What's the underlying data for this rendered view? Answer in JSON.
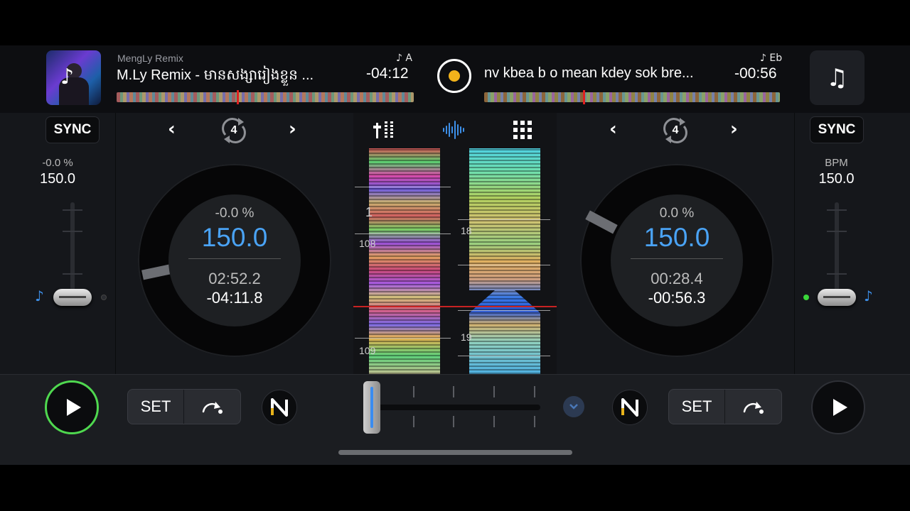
{
  "deck_a": {
    "artist": "MengLy Remix",
    "title": "M.Ly Remix - មានសង្សារៀងខ្លួន ...",
    "key": "♪ A",
    "remaining_header": "-04:12",
    "sync_label": "SYNC",
    "side_pitch": "-0.0 %",
    "side_bpm": "150.0",
    "loop_size": "4",
    "platter": {
      "pitch": "-0.0 %",
      "bpm": "150.0",
      "elapsed": "02:52.2",
      "remaining": "-04:11.8"
    },
    "set_label": "SET",
    "sync_state": "on"
  },
  "deck_b": {
    "title": "nv kbea b o mean kdey sok bre...",
    "key": "♪ Eb",
    "remaining_header": "-00:56",
    "sync_label": "SYNC",
    "side_label": "BPM",
    "side_bpm": "150.0",
    "loop_size": "4",
    "platter": {
      "pitch": "0.0 %",
      "bpm": "150.0",
      "elapsed": "00:28.4",
      "remaining": "-00:56.3"
    },
    "set_label": "SET"
  },
  "waveform": {
    "beat_labels_a": [
      "1",
      "108",
      "109"
    ],
    "beat_labels_b": [
      "18",
      "19"
    ]
  },
  "icons": {
    "deck_a_cover": "music-note-icon",
    "deck_b_cover": "music-note-icon",
    "center_tabs": [
      "mixer-icon",
      "waveform-icon",
      "grid-icon"
    ],
    "fx_button": "n-icon"
  },
  "colors": {
    "accent_blue": "#4aa3f5",
    "play_active": "#4fd84f",
    "record_dot": "#f2b31b",
    "playhead": "#c82222"
  }
}
